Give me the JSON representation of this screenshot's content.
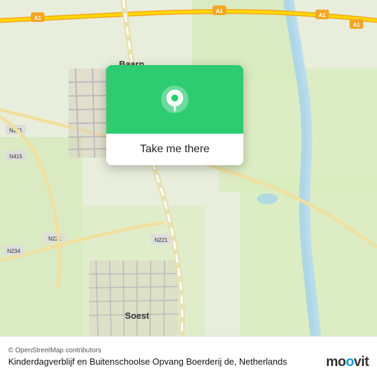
{
  "map": {
    "background_color": "#e8f0d8"
  },
  "popup": {
    "button_label": "Take me there",
    "header_color": "#2ecc71"
  },
  "footer": {
    "attribution": "© OpenStreetMap contributors",
    "title": "Kinderdagverblijf en Buitenschoolse Opvang Boerderij de, Netherlands"
  },
  "moovit": {
    "logo": "moovit"
  },
  "road_labels": [
    "A1",
    "N221",
    "N415",
    "N234",
    "Baarn",
    "Soest"
  ],
  "icons": {
    "location_pin": "📍"
  }
}
